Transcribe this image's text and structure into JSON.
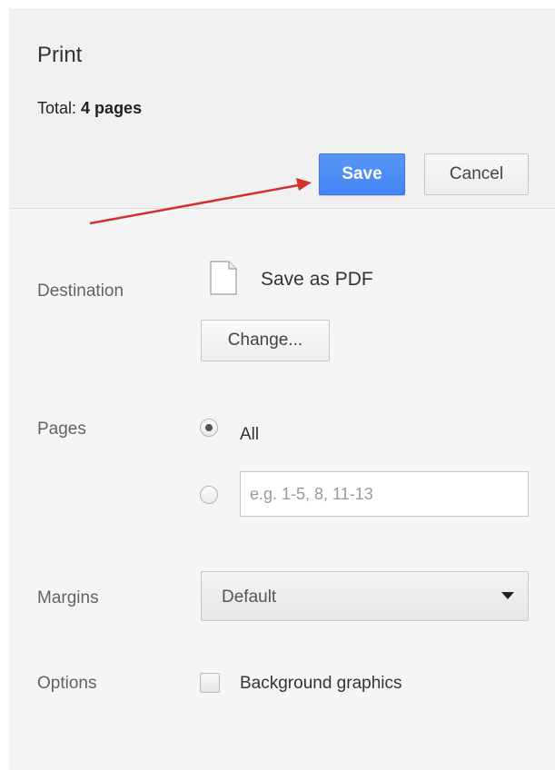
{
  "header": {
    "title": "Print",
    "total_label": "Total:",
    "total_value": "4 pages",
    "save_label": "Save",
    "cancel_label": "Cancel"
  },
  "destination": {
    "label": "Destination",
    "name": "Save as PDF",
    "icon": "file-icon",
    "change_label": "Change..."
  },
  "pages": {
    "label": "Pages",
    "all_label": "All",
    "all_selected": true,
    "range_placeholder": "e.g. 1-5, 8, 11-13",
    "range_value": ""
  },
  "margins": {
    "label": "Margins",
    "selected": "Default"
  },
  "options": {
    "label": "Options",
    "background_graphics_label": "Background graphics",
    "background_graphics_checked": false
  },
  "colors": {
    "accent": "#4285f4",
    "annotation_arrow": "#d32f2f"
  }
}
